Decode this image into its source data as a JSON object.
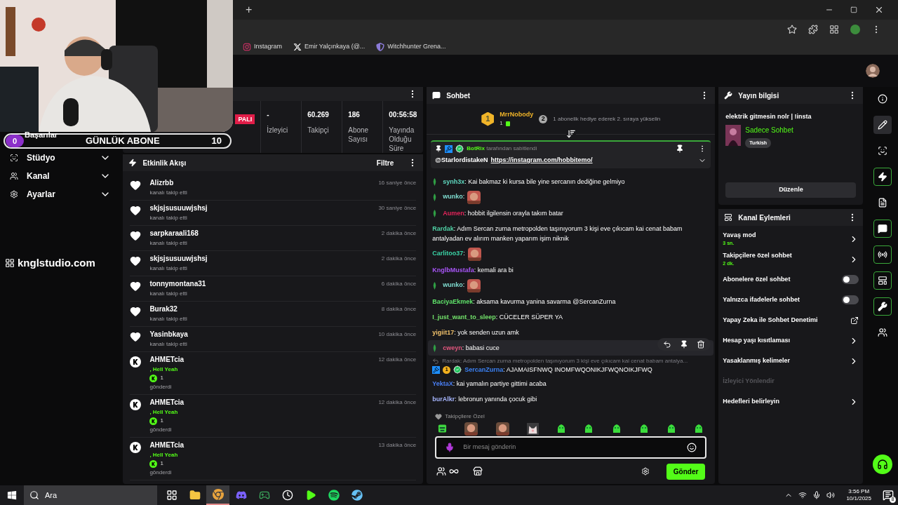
{
  "browser": {
    "new_tab": "+",
    "bookmarks": [
      {
        "kind": "instagram",
        "label": "Instagram"
      },
      {
        "kind": "x",
        "label": "Emir Yalçınkaya (@..."
      },
      {
        "kind": "shield",
        "label": "Witchhunter Grena..."
      }
    ]
  },
  "goal_bar": {
    "count": "0",
    "title": "GÜNLÜK ABONE",
    "target": "10"
  },
  "sidebar": {
    "items": [
      {
        "kind": "link",
        "label": "Başarılar"
      },
      {
        "kind": "group",
        "label": "Stüdyo"
      },
      {
        "kind": "group",
        "label": "Kanal"
      },
      {
        "kind": "group",
        "label": "Ayarlar"
      }
    ],
    "logo": "knglstudio.com"
  },
  "stats": {
    "live_badge": "PALI",
    "items": [
      {
        "value": "-",
        "label": "İzleyici"
      },
      {
        "value": "60.269",
        "label": "Takipçi"
      },
      {
        "value": "186",
        "label": "Abone Sayısı"
      },
      {
        "value": "00:56:58",
        "label": "Yayında Olduğu Süre"
      }
    ]
  },
  "activity": {
    "title": "Etkinlik Akışı",
    "filter": "Filtre",
    "events": [
      {
        "kind": "follow",
        "user": "Alizrbb",
        "action": "kanalı takip etti",
        "time": "16 saniye önce"
      },
      {
        "kind": "follow",
        "user": "skjsjsusuuwjshsj",
        "action": "kanalı takip etti",
        "time": "30 saniye önce"
      },
      {
        "kind": "follow",
        "user": "sarpkaraali168",
        "action": "kanalı takip etti",
        "time": "2 dakika önce"
      },
      {
        "kind": "follow",
        "user": "skjsjsusuuwjshsj",
        "action": "kanalı takip etti",
        "time": "2 dakika önce"
      },
      {
        "kind": "follow",
        "user": "tonnymontana31",
        "action": "kanalı takip etti",
        "time": "6 dakika önce"
      },
      {
        "kind": "follow",
        "user": "Burak32",
        "action": "kanalı takip etti",
        "time": "8 dakika önce"
      },
      {
        "kind": "follow",
        "user": "Yasinbkaya",
        "action": "kanalı takip etti",
        "time": "10 dakika önce"
      },
      {
        "kind": "kicks",
        "user": "AHMETcia",
        "message": ", Hell Yeah",
        "amount": "1",
        "action": "gönderdi",
        "time": "12 dakika önce"
      },
      {
        "kind": "kicks",
        "user": "AHMETcia",
        "message": ", Hell Yeah",
        "amount": "1",
        "action": "gönderdi",
        "time": "12 dakika önce"
      },
      {
        "kind": "kicks",
        "user": "AHMETcia",
        "message": ", Hell Yeah",
        "amount": "1",
        "action": "gönderdi",
        "time": "13 dakika önce"
      }
    ]
  },
  "chat": {
    "title": "Sohbet",
    "leader": {
      "rank": "1",
      "name": "MrrNobody",
      "count": "1",
      "prompt_rank": "2",
      "prompt": "1 abonelik hediye ederek 2. sıraya yükselin"
    },
    "pinned": {
      "by": "BotRix",
      "by_suffix": "tarafından sabitlendi",
      "mention": "@StarlordistakeN",
      "link": "https://instagram.com/hobbitemo/"
    },
    "messages": [
      {
        "kind": "text",
        "user": "synh3x",
        "color": "#5fd9c0",
        "badge": true,
        "hovered": false,
        "text": ": Kai bakmaz ki kursa bile yine sercanın dediğine gelmiyo"
      },
      {
        "kind": "emote",
        "user": "wunko",
        "color": "#7fdcd0",
        "badge": true,
        "hovered": false,
        "text": ":"
      },
      {
        "kind": "text",
        "user": "Aumen",
        "color": "#e3245a",
        "badge": true,
        "hovered": false,
        "text": ": hobbit ilgilensin orayla takım batar"
      },
      {
        "kind": "text",
        "user": "Rardak",
        "color": "#4fd1a5",
        "badge": false,
        "hovered": false,
        "text": ": Adım Sercan zurna metropolden taşınıyorum 3 kişi eve çıkıcam kai cenat babam antalyadan ev alırım manken yaparım işim niknik"
      },
      {
        "kind": "emote",
        "user": "Carlitoo37",
        "color": "#3ad3a6",
        "badge": false,
        "hovered": false,
        "text": ":"
      },
      {
        "kind": "text",
        "user": "KnglbMustafa",
        "color": "#a855f7",
        "badge": false,
        "hovered": false,
        "text": ": kemali ara bi"
      },
      {
        "kind": "emote",
        "user": "wunko",
        "color": "#7fdcd0",
        "badge": true,
        "hovered": false,
        "text": ":"
      },
      {
        "kind": "text",
        "user": "BaciyaEkmek",
        "color": "#5fe36a",
        "badge": false,
        "hovered": false,
        "text": ": aksama kavurma yanina savarma @SercanZurna"
      },
      {
        "kind": "text",
        "user": "I_just_want_to_sleep",
        "color": "#72e26a",
        "badge": false,
        "hovered": false,
        "text": ": CÜCELER SÜPER YA"
      },
      {
        "kind": "text",
        "user": "yigiit17",
        "color": "#f2c26b",
        "badge": false,
        "hovered": false,
        "text": ": yok senden uzun amk"
      },
      {
        "kind": "text",
        "user": "cweyn",
        "color": "#e0557c",
        "badge": true,
        "hovered": true,
        "text": ": babasi cuce"
      },
      {
        "kind": "reply",
        "user": "SercanZurna",
        "color": "#3b82f6",
        "badge": false,
        "hovered": false,
        "sub": "1",
        "reply_to": "Rardak: Adım Sercan zurna metropolden taşınıyorum 3 kişi eve çıkıcam kai cenat babam antalya...",
        "text": ": AJAMAISFNWQ INOMFWQONIKJFWQNOIKJFWQ"
      },
      {
        "kind": "text",
        "user": "YektaX",
        "color": "#4a7ff5",
        "badge": false,
        "hovered": false,
        "text": ": kai yamalın partiye gittimi acaba"
      },
      {
        "kind": "text",
        "user": "burAlkr",
        "color": "#a5b4fc",
        "badge": false,
        "hovered": false,
        "text": ": lebronun yanında çocuk gibi"
      }
    ],
    "emote_label": "Takipçilere Özel",
    "input": {
      "placeholder": "Bir mesaj gönderin"
    },
    "send": "Gönder"
  },
  "stream_info": {
    "title": "Yayın bilgisi",
    "stream_title": "elektrik gitmesin nolr | !insta",
    "category": "Sadece Sohbet",
    "tag": "Turkish",
    "edit": "Düzenle"
  },
  "channel_actions": {
    "title": "Kanal Eylemleri",
    "items": [
      {
        "kind": "link",
        "label": "Yavaş mod",
        "value": "3 sn."
      },
      {
        "kind": "link",
        "label": "Takipçilere özel sohbet",
        "value": "2 dk."
      },
      {
        "kind": "toggle",
        "label": "Abonelere özel sohbet",
        "on": false
      },
      {
        "kind": "toggle",
        "label": "Yalnızca ifadelerle sohbet",
        "on": false
      },
      {
        "kind": "external",
        "label": "Yapay Zeka ile Sohbet Denetimi"
      },
      {
        "kind": "link",
        "label": "Hesap yaşı kısıtlaması"
      },
      {
        "kind": "link",
        "label": "Yasaklanmış kelimeler"
      },
      {
        "kind": "disabled",
        "label": "İzleyici Yönlendir"
      },
      {
        "kind": "link",
        "label": "Hedefleri belirleyin"
      }
    ]
  },
  "rail": [
    {
      "kind": "info",
      "selected": false,
      "outlined": false
    },
    {
      "kind": "pencil",
      "selected": true,
      "outlined": false
    },
    {
      "kind": "focus",
      "selected": false,
      "outlined": false
    },
    {
      "kind": "bolt",
      "selected": false,
      "outlined": true
    },
    {
      "kind": "document",
      "selected": false,
      "outlined": false
    },
    {
      "kind": "chat",
      "selected": false,
      "outlined": true
    },
    {
      "kind": "broadcast",
      "selected": false,
      "outlined": true
    },
    {
      "kind": "layout",
      "selected": false,
      "outlined": true
    },
    {
      "kind": "wrench",
      "selected": false,
      "outlined": true
    },
    {
      "kind": "dots",
      "selected": false,
      "outlined": false
    }
  ],
  "taskbar": {
    "search": "Ara",
    "apps": [
      {
        "kind": "tasks",
        "selected": false
      },
      {
        "kind": "folder",
        "selected": false
      },
      {
        "kind": "chrome",
        "selected": true
      },
      {
        "kind": "discord",
        "selected": false
      },
      {
        "kind": "xbox",
        "selected": false
      },
      {
        "kind": "clock",
        "selected": false
      },
      {
        "kind": "play",
        "selected": false
      },
      {
        "kind": "spotify",
        "selected": false
      },
      {
        "kind": "steam",
        "selected": false
      }
    ],
    "time": "3:56 PM",
    "date": "10/1/2025",
    "notifications": "8"
  }
}
